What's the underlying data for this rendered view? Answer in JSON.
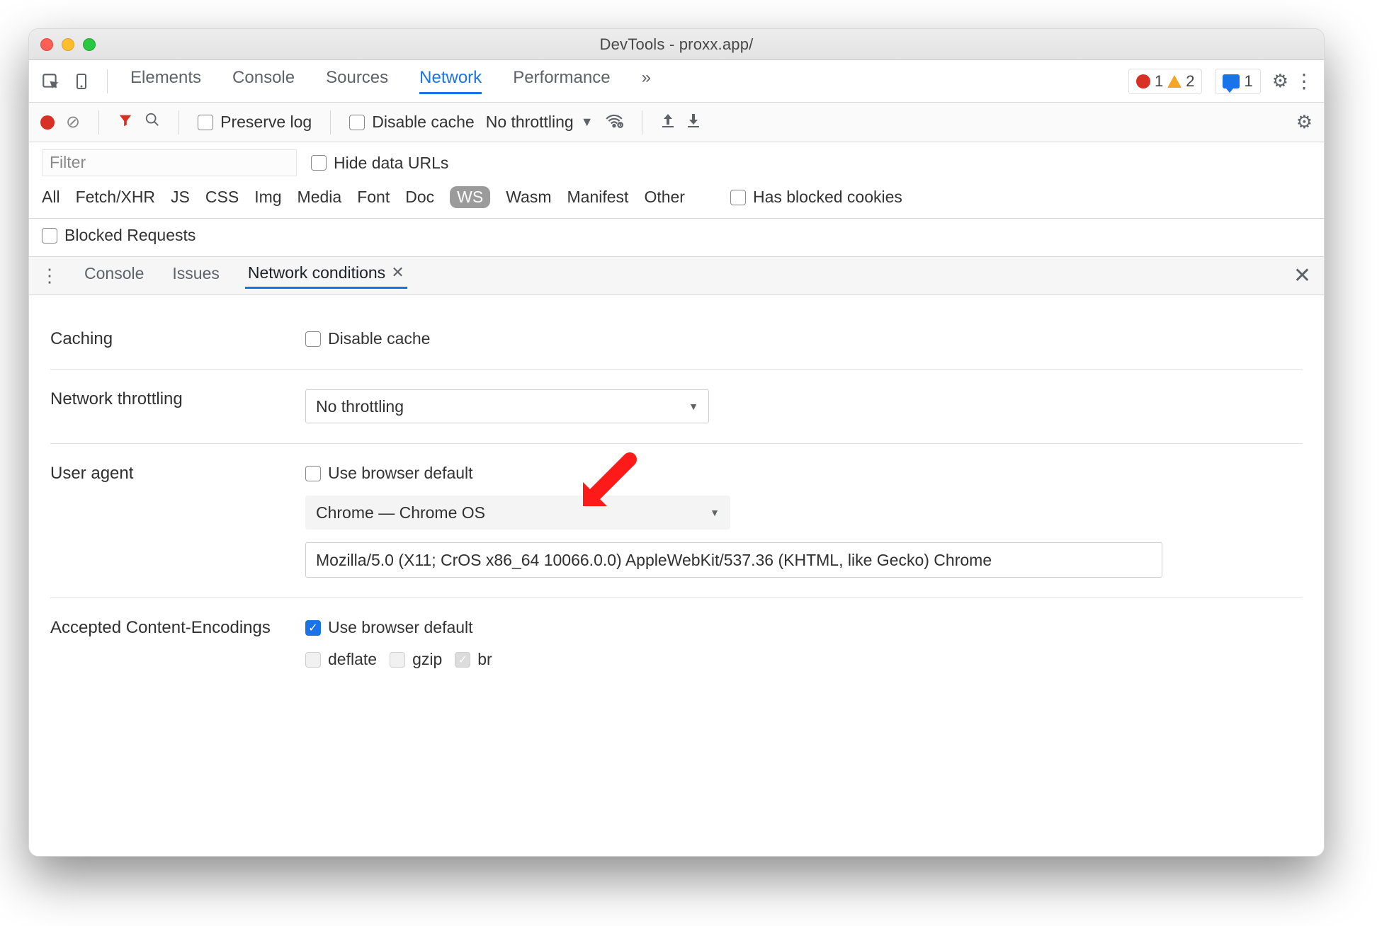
{
  "window": {
    "title": "DevTools - proxx.app/"
  },
  "tabs": {
    "items": [
      "Elements",
      "Console",
      "Sources",
      "Network",
      "Performance"
    ],
    "active": "Network",
    "overflow_glyph": "»"
  },
  "counters": {
    "errors": "1",
    "warnings": "2",
    "messages": "1"
  },
  "network_toolbar": {
    "preserve_log": "Preserve log",
    "disable_cache": "Disable cache",
    "throttling_selected": "No throttling"
  },
  "filter": {
    "placeholder": "Filter",
    "hide_data_urls": "Hide data URLs",
    "types": [
      "All",
      "Fetch/XHR",
      "JS",
      "CSS",
      "Img",
      "Media",
      "Font",
      "Doc",
      "WS",
      "Wasm",
      "Manifest",
      "Other"
    ],
    "active_type": "WS",
    "has_blocked_cookies": "Has blocked cookies",
    "blocked_requests": "Blocked Requests"
  },
  "drawer": {
    "tabs": [
      "Console",
      "Issues",
      "Network conditions"
    ],
    "active": "Network conditions"
  },
  "conditions": {
    "caching_label": "Caching",
    "caching_disable": "Disable cache",
    "throttling_label": "Network throttling",
    "throttling_selected": "No throttling",
    "ua_label": "User agent",
    "ua_use_default": "Use browser default",
    "ua_selected": "Chrome — Chrome OS",
    "ua_string": "Mozilla/5.0 (X11; CrOS x86_64 10066.0.0) AppleWebKit/537.36 (KHTML, like Gecko) Chrome",
    "enc_label": "Accepted Content-Encodings",
    "enc_use_default": "Use browser default",
    "enc_options": [
      "deflate",
      "gzip",
      "br"
    ]
  }
}
